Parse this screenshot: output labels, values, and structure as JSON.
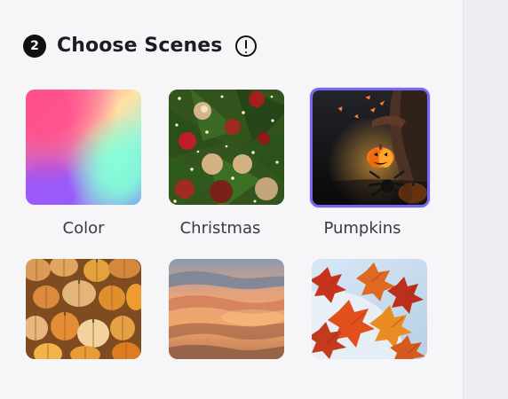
{
  "section": {
    "step_number": "2",
    "title": "Choose Scenes",
    "info_icon": "info-icon"
  },
  "scenes": [
    {
      "label": "Color",
      "selected": false
    },
    {
      "label": "Christmas",
      "selected": false
    },
    {
      "label": "Pumpkins",
      "selected": true
    },
    {
      "label": "",
      "selected": false
    },
    {
      "label": "",
      "selected": false
    },
    {
      "label": "",
      "selected": false
    }
  ],
  "colors": {
    "selected_border": "#7567f2",
    "panel_background": "#f6f6f9",
    "side_background": "#efeff3",
    "text": "#1c1c22"
  }
}
